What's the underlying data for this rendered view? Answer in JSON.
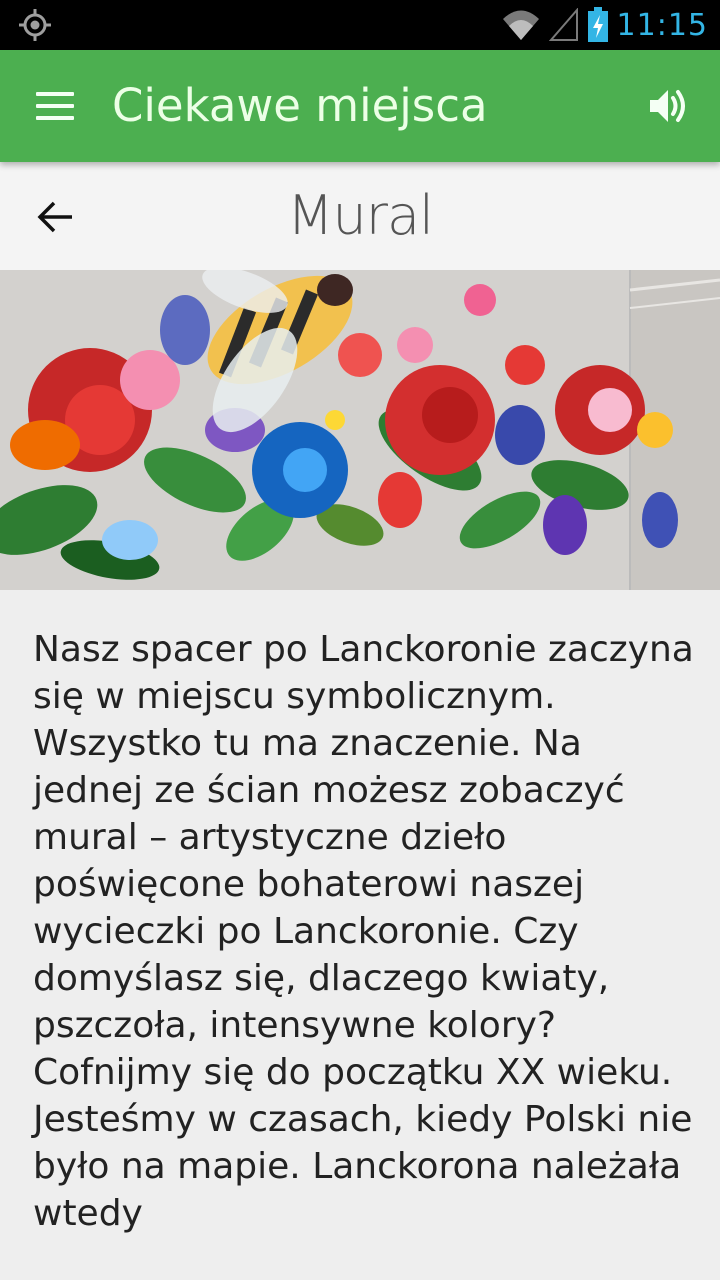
{
  "status_bar": {
    "time": "11:15",
    "icons": [
      "location-icon",
      "wifi-icon",
      "cell-signal-icon",
      "battery-charging-icon"
    ]
  },
  "app_bar": {
    "title": "Ciekawe miejsca",
    "icons": [
      "menu-icon",
      "volume-icon"
    ]
  },
  "detail": {
    "title": "Mural",
    "back_icon": "arrow-back-icon",
    "image_alt": "Mural",
    "text": "Nasz spacer po Lanckoronie zaczyna się w miejscu symbolicznym. Wszystko tu ma znaczenie. Na jednej ze ścian możesz zobaczyć mural – artystyczne dzieło poświęcone bohaterowi naszej wycieczki po Lanckoronie. Czy domyślasz się, dlaczego kwiaty, pszczoła, intensywne kolory? Cofnijmy się do początku XX wieku. Jesteśmy w czasach, kiedy Polski nie było na mapie. Lanckorona należała wtedy"
  },
  "colors": {
    "app_bar": "#4caf50",
    "status_accent": "#33b5e5",
    "background": "#eeeeee"
  }
}
